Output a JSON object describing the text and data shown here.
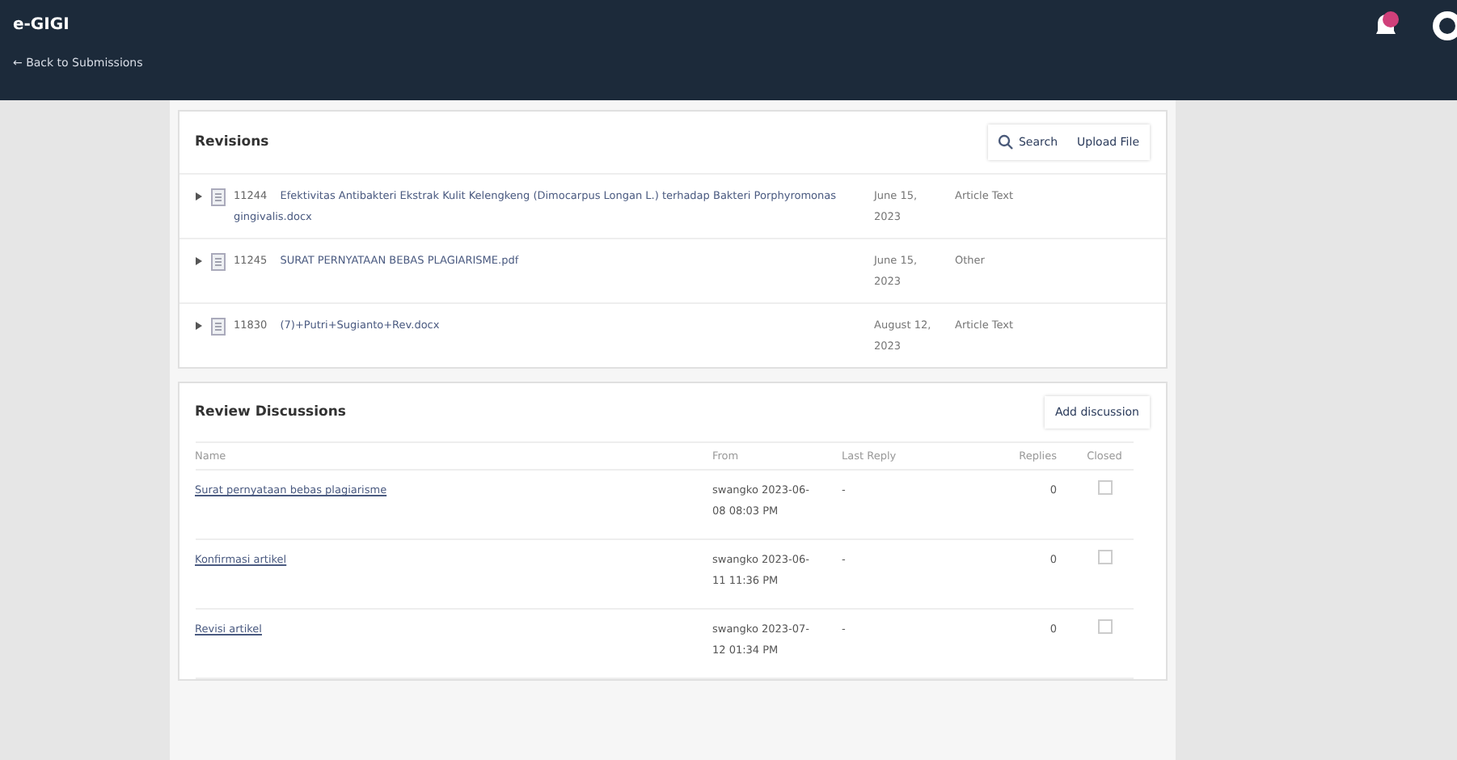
{
  "header": {
    "title": "e-GIGI",
    "back_link": "← Back to Submissions"
  },
  "revisions": {
    "title": "Revisions",
    "buttons": [
      "Search",
      "Upload File"
    ],
    "files": [
      {
        "id": "11244",
        "name": "Efektivitas Antibakteri Ekstrak Kulit Kelengkeng (Dimocarpus Longan L.) terhadap Bakteri Porphyromonas gingivalis.docx",
        "date": "June 15, 2023",
        "type": "Article Text"
      },
      {
        "id": "11245",
        "name": "SURAT PERNYATAAN BEBAS PLAGIARISME.pdf",
        "date": "June 15, 2023",
        "type": "Other"
      },
      {
        "id": "11830",
        "name": "(7)+Putri+Sugianto+Rev.docx",
        "date": "August 12, 2023",
        "type": "Article Text"
      }
    ]
  },
  "discussions": {
    "title": "Review Discussions",
    "button": "Add discussion",
    "columns": [
      "Name",
      "From",
      "Last Reply",
      "Replies",
      "Closed"
    ],
    "rows": [
      {
        "name": "Surat pernyataan bebas plagiarisme",
        "from": "swangko 2023-06-08 08:03 PM",
        "last_reply": "-",
        "replies": "0",
        "closed": false
      },
      {
        "name": "Konfirmasi artikel",
        "from": "swangko 2023-06-11 11:36 PM",
        "last_reply": "-",
        "replies": "0",
        "closed": false
      },
      {
        "name": "Revisi artikel",
        "from": "swangko 2023-07-12 01:34 PM",
        "last_reply": "-",
        "replies": "0",
        "closed": false
      }
    ]
  }
}
